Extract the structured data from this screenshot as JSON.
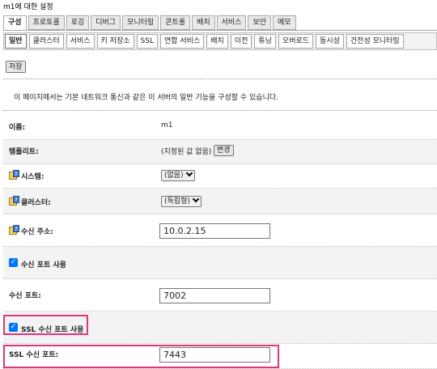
{
  "page_title": "m1에 대한 설정",
  "main_tabs": [
    {
      "label": "구성",
      "active": true
    },
    {
      "label": "프로토콜",
      "active": false
    },
    {
      "label": "로깅",
      "active": false
    },
    {
      "label": "디버그",
      "active": false
    },
    {
      "label": "모니터링",
      "active": false
    },
    {
      "label": "콘트롤",
      "active": false
    },
    {
      "label": "배치",
      "active": false
    },
    {
      "label": "서비스",
      "active": false
    },
    {
      "label": "보안",
      "active": false
    },
    {
      "label": "메모",
      "active": false
    }
  ],
  "sub_tabs": [
    {
      "label": "일반",
      "active": true
    },
    {
      "label": "클러스터",
      "active": false
    },
    {
      "label": "서비스",
      "active": false
    },
    {
      "label": "키 저장소",
      "active": false
    },
    {
      "label": "SSL",
      "active": false
    },
    {
      "label": "연합 서비스",
      "active": false
    },
    {
      "label": "배치",
      "active": false
    },
    {
      "label": "이전",
      "active": false
    },
    {
      "label": "튜닝",
      "active": false
    },
    {
      "label": "오버로드",
      "active": false
    },
    {
      "label": "동시성",
      "active": false
    },
    {
      "label": "건전성 모니터링",
      "active": false
    }
  ],
  "save_label": "저장",
  "intro_text": "이 페이지에서는 기본 네트워크 통신과 같은 이 서버의 일반 기능을 구성할 수 있습니다.",
  "form": {
    "name": {
      "label": "이름:",
      "value": "m1"
    },
    "template": {
      "label": "템플리트:",
      "value": "(지정된 값 없음)",
      "button": "변경"
    },
    "machine": {
      "label": "시스템:",
      "selected": "(없음)"
    },
    "cluster": {
      "label": "클러스터:",
      "selected": "(독립형)"
    },
    "listen_address": {
      "label": "수신 주소:",
      "value": "10.0.2.15"
    },
    "listen_port_enabled": {
      "label": "수신 포트 사용",
      "checked": true
    },
    "listen_port": {
      "label": "수신 포트:",
      "value": "7002"
    },
    "ssl_listen_port_enabled": {
      "label": "SSL 수신 포트 사용",
      "checked": true
    },
    "ssl_listen_port": {
      "label": "SSL 수신 포트:",
      "value": "7443"
    }
  },
  "icons": {
    "help": "help-icon",
    "checkmark": "check-icon",
    "dropdown": "chevron-down-icon"
  },
  "colors": {
    "highlight": "#e0357a",
    "checkbox": "#0075ff"
  }
}
